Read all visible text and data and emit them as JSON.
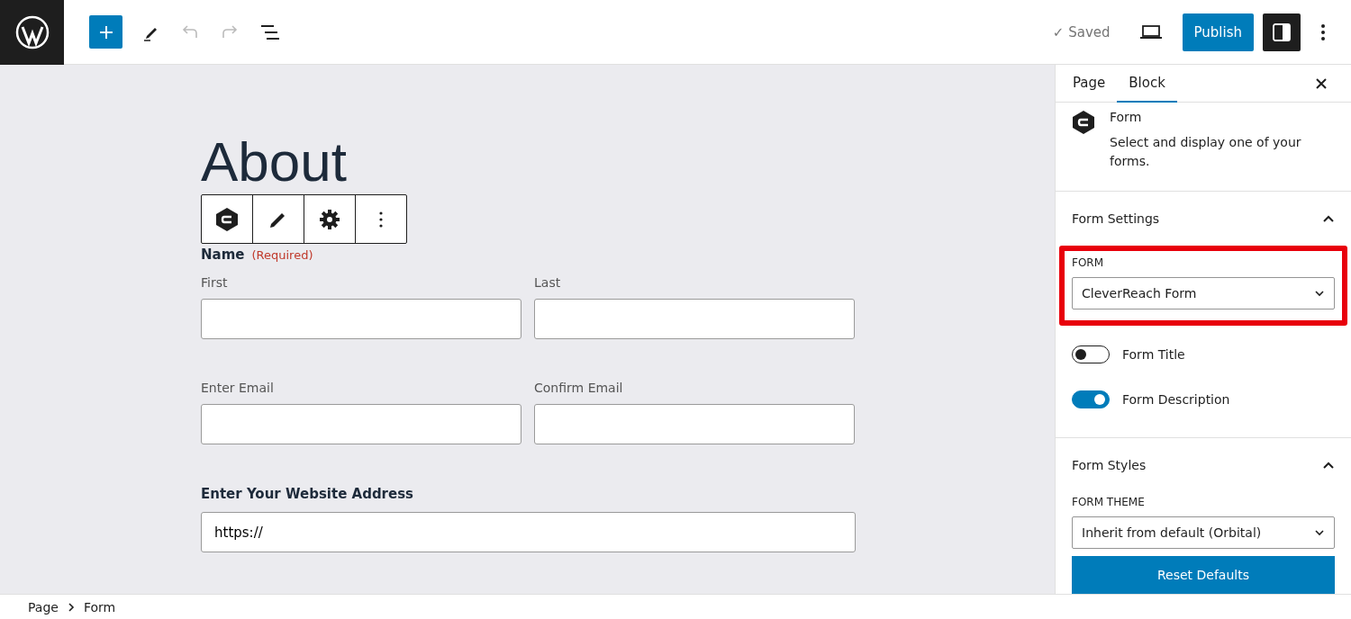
{
  "top_bar": {
    "undo": {
      "disabled": true
    },
    "redo": {
      "disabled": true
    },
    "saved_status": "✓ Saved",
    "publish_button": "Publish",
    "settings_toggle": {
      "on": true
    }
  },
  "canvas": {
    "heading": "About",
    "form": {
      "name_label": "Name",
      "required_label": "(Required)",
      "name_fields": [
        {
          "label": "First"
        },
        {
          "label": "Last"
        }
      ],
      "email_fields": [
        {
          "label": "Enter Email"
        },
        {
          "label": "Confirm Email"
        }
      ],
      "website": {
        "label": "Enter Your Website Address",
        "value": "https://"
      }
    }
  },
  "sidebar": {
    "tabs": [
      {
        "label": "Page",
        "selected": false
      },
      {
        "label": "Block",
        "selected": true
      }
    ],
    "block": {
      "title": "Form",
      "description": "Select and display one of your forms."
    },
    "form_settings": {
      "title": "Form Settings",
      "expanded": true,
      "select_label": "FORM",
      "select_value": "CleverReach Form",
      "highlighted": true,
      "toggles": [
        {
          "label": "Form Title",
          "on": false
        },
        {
          "label": "Form Description",
          "on": true
        }
      ]
    },
    "form_styles": {
      "title": "Form Styles",
      "expanded": true,
      "theme_label": "FORM THEME",
      "theme_value": "Inherit from default (Orbital)",
      "reset_button": "Reset Defaults"
    }
  },
  "breadcrumbs": [
    "Page",
    "Form"
  ]
}
